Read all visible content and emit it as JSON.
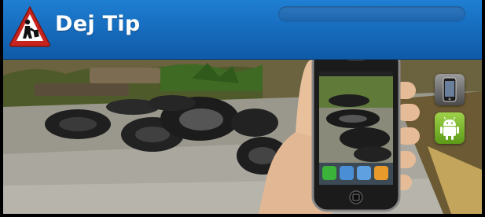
{
  "header": {
    "title": "Dej Tip",
    "logo_icon": "warning-triangle-icon",
    "brand_color": "#176dbf"
  },
  "platforms": {
    "iphone_icon": "iphone-icon",
    "android_icon": "android-robot-icon",
    "android_color": "#7cb830"
  }
}
